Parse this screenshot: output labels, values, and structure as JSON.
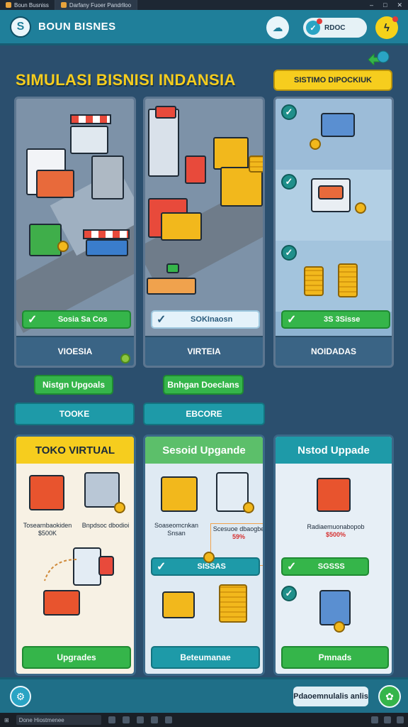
{
  "os": {
    "tabs": [
      {
        "label": "Boun Busniss"
      },
      {
        "label": "Darfany Fuoer Pandrlloo"
      }
    ]
  },
  "header": {
    "brand": "BOUN BISNES",
    "pill_label": "RDOC"
  },
  "title": {
    "heading": "SIMULASI BISNISI INDANSIA",
    "badge": "SISTIMO DIPOCKIUK"
  },
  "scenes": [
    {
      "status": "Sosia Sa Cos",
      "caption": "VIOESIA"
    },
    {
      "status": "SOKInaosn",
      "caption": "VIRTEIA"
    },
    {
      "status": "3S 3Sisse",
      "caption": "NOIDADAS"
    }
  ],
  "actions": {
    "green": [
      "Nistgn Upgoals",
      "Bnhgan Doeclans"
    ],
    "teal": [
      "TOOKE",
      "EBCORE"
    ]
  },
  "cards": [
    {
      "title": "TOKO VIRTUAL",
      "caption_left": "Tosearnbaokiden",
      "caption_left_price": "$500K",
      "caption_right": "Bnpdsoc dbodioi",
      "button": "Upgrades"
    },
    {
      "title": "Sesoid Upgande",
      "caption_left": "Soaseomcnkan",
      "caption_left_sub": "Snsan",
      "caption_right": "Scesuoe dbaogbe",
      "caption_right_price": "59%",
      "stat": "SISSAS",
      "button": "Beteumanae"
    },
    {
      "title": "Nstod Uppade",
      "caption": "Radiaemuonabopob",
      "price": "$500%",
      "stat": "SGSSS",
      "button": "Pmnads"
    }
  ],
  "footer": {
    "pill": "Pdaoemnulalis anlis"
  },
  "taskbar": {
    "search": "Done Hiostmenee"
  },
  "colors": {
    "background": "#2b4f6e",
    "header": "#1f7f9a",
    "title_yellow": "#f6cd1e",
    "green": "#35b54a",
    "teal": "#1e9aa8"
  }
}
